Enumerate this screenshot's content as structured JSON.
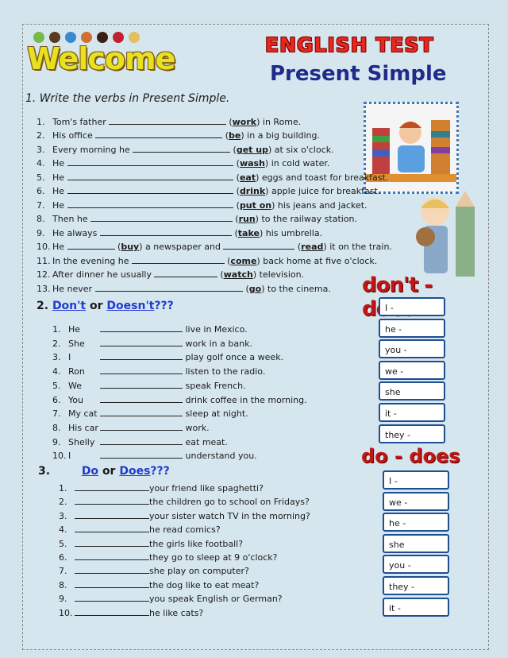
{
  "header": {
    "logo_text": "Welcome",
    "title": "ENGLISH TEST",
    "subtitle": "Present Simple"
  },
  "section1": {
    "heading": "1. Write the verbs in Present Simple.",
    "items": [
      {
        "n": "1.",
        "before": "Tom's father",
        "verb": "work",
        "after": "in Rome."
      },
      {
        "n": "2.",
        "before": "His office",
        "verb": "be",
        "after": "in a big building."
      },
      {
        "n": "3.",
        "before": "Every morning he",
        "verb": "get up",
        "after": "at six o'clock."
      },
      {
        "n": "4.",
        "before": "He",
        "verb": "wash",
        "after": "in cold water."
      },
      {
        "n": "5.",
        "before": "He",
        "verb": "eat",
        "after": "eggs and toast for breakfast."
      },
      {
        "n": "6.",
        "before": "He",
        "verb": "drink",
        "after": "apple juice for breakfast."
      },
      {
        "n": "7.",
        "before": "He",
        "verb": "put on",
        "after": "his jeans and jacket."
      },
      {
        "n": "8.",
        "before": "Then he",
        "verb": "run",
        "after": "to the railway station."
      },
      {
        "n": "9.",
        "before": "He always",
        "verb": "take",
        "after": "his umbrella."
      },
      {
        "n": "10.",
        "before": "He",
        "verb": "buy",
        "after": "a newspaper and",
        "verb2": "read",
        "after2": "it on the train."
      },
      {
        "n": "11.",
        "before": "In the evening he",
        "verb": "come",
        "after": "back home at five o'clock."
      },
      {
        "n": "12.",
        "before": "After dinner he usually",
        "verb": "watch",
        "after": "television."
      },
      {
        "n": "13.",
        "before": "He never",
        "verb": "go",
        "after": "to the cinema."
      }
    ]
  },
  "section2": {
    "num": "2.",
    "word1": "Don't",
    "or": "or",
    "word2": "Doesn't",
    "qmarks": "???",
    "items": [
      {
        "n": "1.",
        "before": "He",
        "after": "live in Mexico."
      },
      {
        "n": "2.",
        "before": "She",
        "after": "work in a bank."
      },
      {
        "n": "3.",
        "before": "I",
        "after": "play golf once a week."
      },
      {
        "n": "4.",
        "before": "Ron",
        "after": "listen to the radio."
      },
      {
        "n": "5.",
        "before": "We",
        "after": "speak French."
      },
      {
        "n": "6.",
        "before": "You",
        "after": "drink coffee in the morning."
      },
      {
        "n": "7.",
        "before": "My cat",
        "after": "sleep at night."
      },
      {
        "n": "8.",
        "before": "His car",
        "after": "work."
      },
      {
        "n": "9.",
        "before": "Shelly",
        "after": "eat meat."
      },
      {
        "n": "10.",
        "before": "I",
        "after": "understand you."
      }
    ]
  },
  "section3": {
    "num": "3.",
    "word1": "Do",
    "or": "or",
    "word2": "Does",
    "qmarks": "???",
    "items": [
      {
        "n": "1.",
        "after": "your friend like spaghetti?"
      },
      {
        "n": "2.",
        "after": "the children go to school on Fridays?"
      },
      {
        "n": "3.",
        "after": "your sister watch TV in the morning?"
      },
      {
        "n": "4.",
        "after": "he read comics?"
      },
      {
        "n": "5.",
        "after": "the girls like football?"
      },
      {
        "n": "6.",
        "after": "they go to sleep at 9 o'clock?"
      },
      {
        "n": "7.",
        "after": "she play on computer?"
      },
      {
        "n": "8.",
        "after": "the dog like to eat meat?"
      },
      {
        "n": "9.",
        "after": "you speak English or German?"
      },
      {
        "n": "10.",
        "after": "he like cats?"
      }
    ]
  },
  "side_boxes": {
    "dont_title": "don't - doesn't",
    "dont_items": [
      "I -",
      "he -",
      "you -",
      "we -",
      "she",
      "it -",
      "they -"
    ],
    "do_title": "do - does",
    "do_items": [
      "I -",
      "we -",
      "he -",
      "she",
      "you -",
      "they -",
      "it -"
    ]
  },
  "colors": {
    "background": "#d3e4ec",
    "title_red": "#e8281e",
    "subtitle_blue": "#1f2a8a",
    "link_blue": "#1f3bd0",
    "box_border": "#1f4f90",
    "box_title_red": "#c01616"
  }
}
